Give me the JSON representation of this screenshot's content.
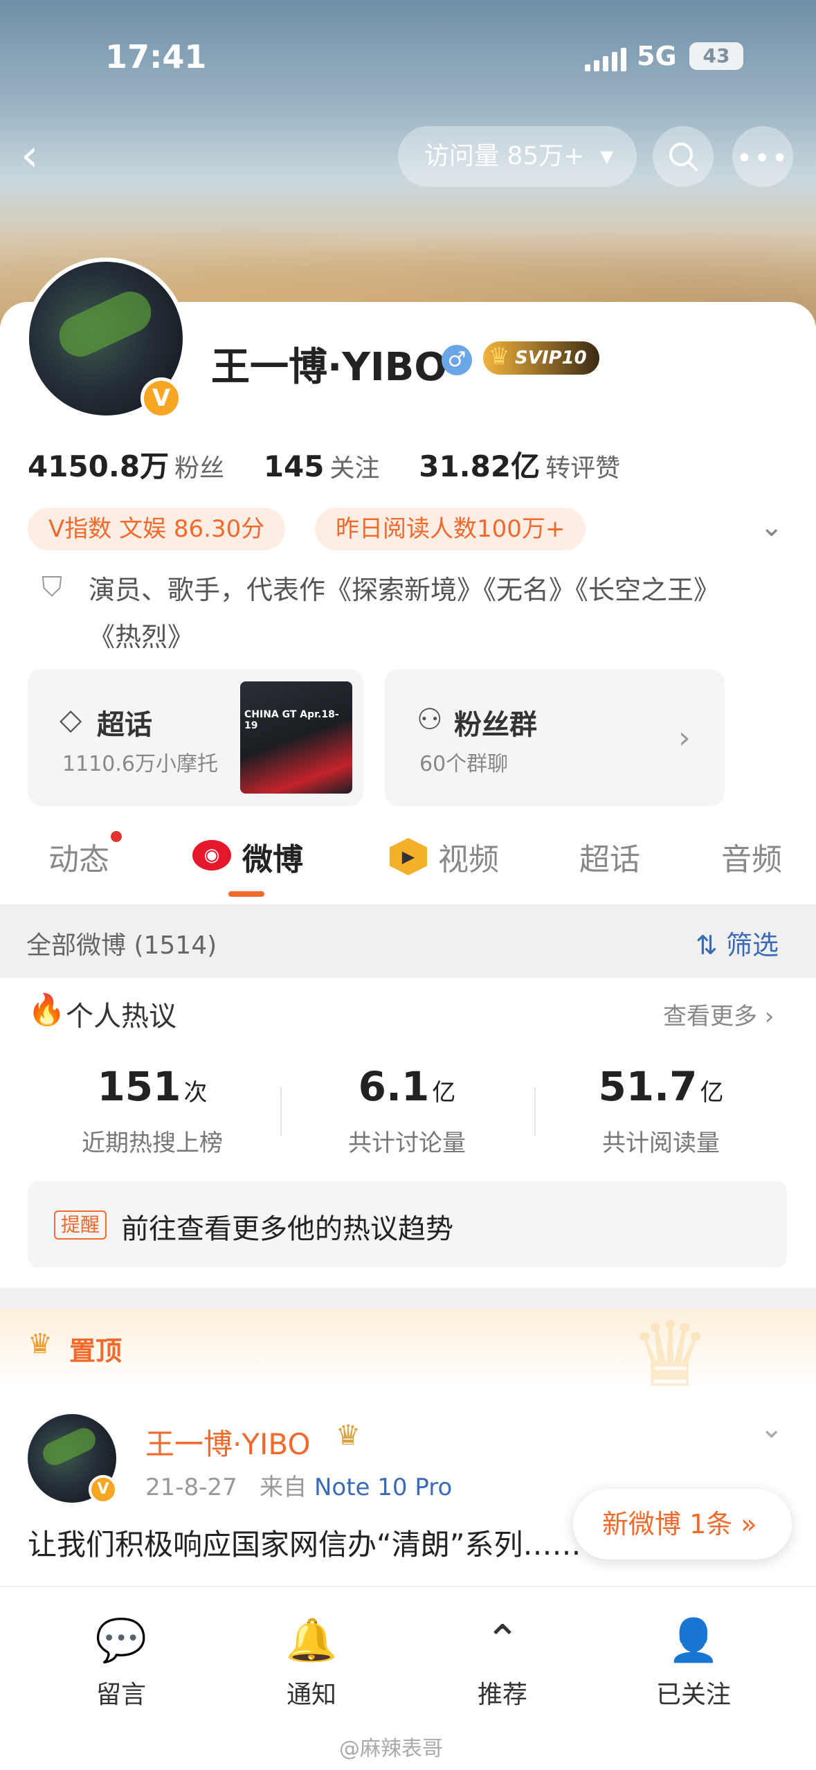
{
  "status_bar": {
    "time": "17:41",
    "network": "5G",
    "battery": "43"
  },
  "header": {
    "visits_label": "访问量 85万+"
  },
  "profile": {
    "name": "王一博·YIBO",
    "svip": "SVIP10",
    "verified_badge": "V",
    "followers_count": "4150.8万",
    "followers_label": "粉丝",
    "following_count": "145",
    "following_label": "关注",
    "engagement_count": "31.82亿",
    "engagement_label": "转评赞",
    "tags": [
      "V指数 文娱 86.30分",
      "昨日阅读人数100万+"
    ],
    "bio": "演员、歌手，代表作《探索新境》《无名》《长空之王》《热烈》"
  },
  "boxes": {
    "topic_title": "超话",
    "topic_sub": "1110.6万小摩托",
    "topic_thumb_text": "CHINA GT Apr.18-19",
    "fans_title": "粉丝群",
    "fans_sub": "60个群聊"
  },
  "tabs": [
    "动态",
    "微博",
    "视频",
    "超话",
    "音频"
  ],
  "filter": {
    "all_label": "全部微博 (1514)",
    "filter_label": "筛选"
  },
  "hot": {
    "title": "个人热议",
    "more": "查看更多",
    "metrics": [
      {
        "num": "151",
        "unit": "次",
        "label": "近期热搜上榜"
      },
      {
        "num": "6.1",
        "unit": "亿",
        "label": "共计讨论量"
      },
      {
        "num": "51.7",
        "unit": "亿",
        "label": "共计阅读量"
      }
    ],
    "remind_badge": "提醒",
    "remind_text": "前往查看更多他的热议趋势"
  },
  "pinned": {
    "label": "置顶"
  },
  "post": {
    "author": "王一博·YIBO",
    "date": "21-8-27",
    "from_label": "来自",
    "source": "Note 10 Pro",
    "text": "让我们积极响应国家网信办“清朗”系列……"
  },
  "new_post": {
    "label": "新微博 1条"
  },
  "bottom_nav": [
    {
      "label": "留言",
      "icon": "message-icon"
    },
    {
      "label": "通知",
      "icon": "bell-icon"
    },
    {
      "label": "推荐",
      "icon": "recommend-icon"
    },
    {
      "label": "已关注",
      "icon": "followed-icon"
    }
  ],
  "watermark": "@麻辣表哥",
  "colors": {
    "accent": "#f26a2b",
    "link": "#3b6ab8",
    "vip_gold": "#f6a623"
  }
}
